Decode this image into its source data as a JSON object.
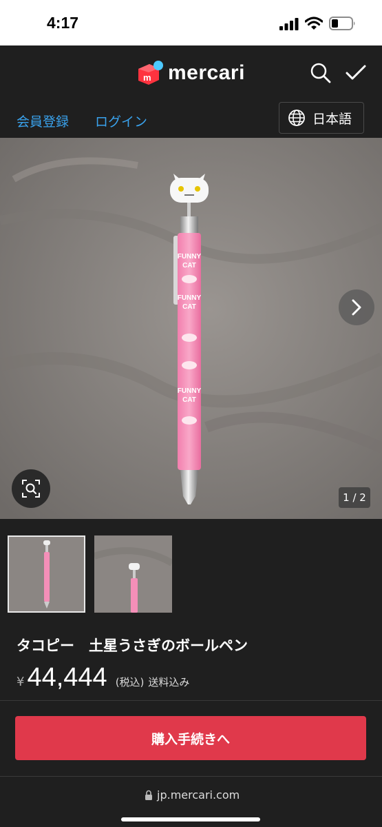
{
  "status": {
    "time": "4:17"
  },
  "header": {
    "brand": "mercari",
    "register_link": "会員登録",
    "login_link": "ログイン",
    "language": "日本語"
  },
  "gallery": {
    "counter": "1 / 2",
    "pen_texts": [
      "FUNNY",
      "CAT",
      "FUNNY",
      "CAT",
      "FUNNY",
      "CAT"
    ]
  },
  "product": {
    "title": "タコピー　土星うさぎのボールペン",
    "currency": "¥",
    "price": "44,444",
    "tax_note": "(税込)",
    "shipping_note": "送料込み",
    "buy_label": "購入手続きへ"
  },
  "browser": {
    "url": "jp.mercari.com"
  },
  "colors": {
    "accent": "#e0394b",
    "link": "#3aa3ee",
    "background": "#1f1f1f",
    "brand_red": "#ff333f",
    "brand_blue": "#4dc9ff"
  }
}
